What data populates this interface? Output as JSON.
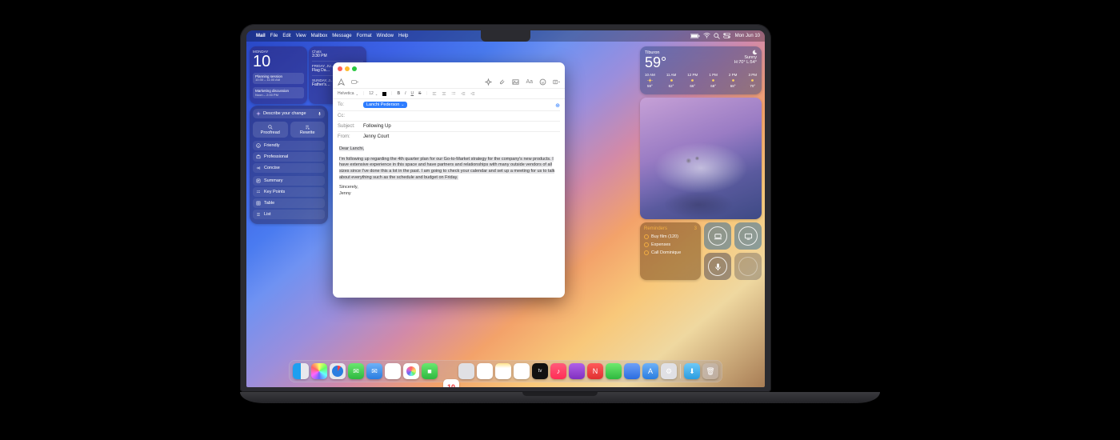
{
  "menubar": {
    "app": "Mail",
    "items": [
      "File",
      "Edit",
      "View",
      "Mailbox",
      "Message",
      "Format",
      "Window",
      "Help"
    ],
    "date": "Mon Jun 10"
  },
  "calendar_widget": {
    "dow": "MONDAY",
    "day": "10",
    "events": [
      {
        "title": "Planning session",
        "time": "10:30 – 11:00 AM"
      },
      {
        "title": "Marketing discussion",
        "time": "Noon – 2:00 PM"
      }
    ]
  },
  "calendar_upcoming": {
    "items": [
      {
        "label": "Chats",
        "text": "3:30 PM"
      },
      {
        "label": "FRIDAY, JU…",
        "text": "Flag Da…"
      },
      {
        "label": "SUNDAY, J…",
        "text": "Father's…"
      }
    ]
  },
  "writing_tools": {
    "prompt": "Describe your change",
    "proofread": "Proofread",
    "rewrite": "Rewrite",
    "styles": [
      {
        "icon": "smile-icon",
        "label": "Friendly"
      },
      {
        "icon": "briefcase-icon",
        "label": "Professional"
      },
      {
        "icon": "arrow-in-icon",
        "label": "Concise"
      }
    ],
    "transforms": [
      {
        "icon": "summary-icon",
        "label": "Summary"
      },
      {
        "icon": "keypoints-icon",
        "label": "Key Points"
      },
      {
        "icon": "table-icon",
        "label": "Table"
      },
      {
        "icon": "list-icon",
        "label": "List"
      }
    ]
  },
  "weather": {
    "location": "Tiburon",
    "temp": "59°",
    "condition": "Sunny",
    "hilo": "H:70° L:54°",
    "hours": [
      {
        "t": "10 AM",
        "d": "59°"
      },
      {
        "t": "11 AM",
        "d": "62°"
      },
      {
        "t": "12 PM",
        "d": "66°"
      },
      {
        "t": "1 PM",
        "d": "68°"
      },
      {
        "t": "2 PM",
        "d": "68°"
      },
      {
        "t": "3 PM",
        "d": "70°"
      }
    ]
  },
  "reminders": {
    "title": "Reminders",
    "count": "3",
    "items": [
      "Buy film (120)",
      "Expenses",
      "Call Dominique"
    ]
  },
  "mail": {
    "format_font": "Helvetica",
    "format_size": "12",
    "to_label": "To:",
    "cc_label": "Cc:",
    "subject_label": "Subject:",
    "from_label": "From:",
    "to_value": "Lanchi Pederson",
    "cc_value": "",
    "subject_value": "Following Up",
    "from_value": "Jenny Court",
    "greeting": "Dear Lanchi,",
    "body": "I'm following up regarding the 4th quarter plan for our Go-to-Market strategy for the company's new products. I have extensive experience in this space and have partners and relationships with many outside vendors of all sizes since I've done this a lot in the past. I am going to check your calendar and set up a meeting for us to talk about everything such as the schedule and budget on Friday.",
    "signoff": "Sincerely,",
    "sig": "Jenny"
  },
  "dock": {
    "cal_day": "10",
    "apps": [
      "Finder",
      "Launchpad",
      "Safari",
      "Messages",
      "Mail",
      "Maps",
      "Photos",
      "FaceTime",
      "Calendar",
      "Contacts",
      "Reminders",
      "Notes",
      "Freeform",
      "TV",
      "Music",
      "Podcasts",
      "News",
      "Numbers",
      "Keynote",
      "App Store",
      "System Settings"
    ],
    "extras": [
      "Downloads",
      "Trash"
    ]
  }
}
